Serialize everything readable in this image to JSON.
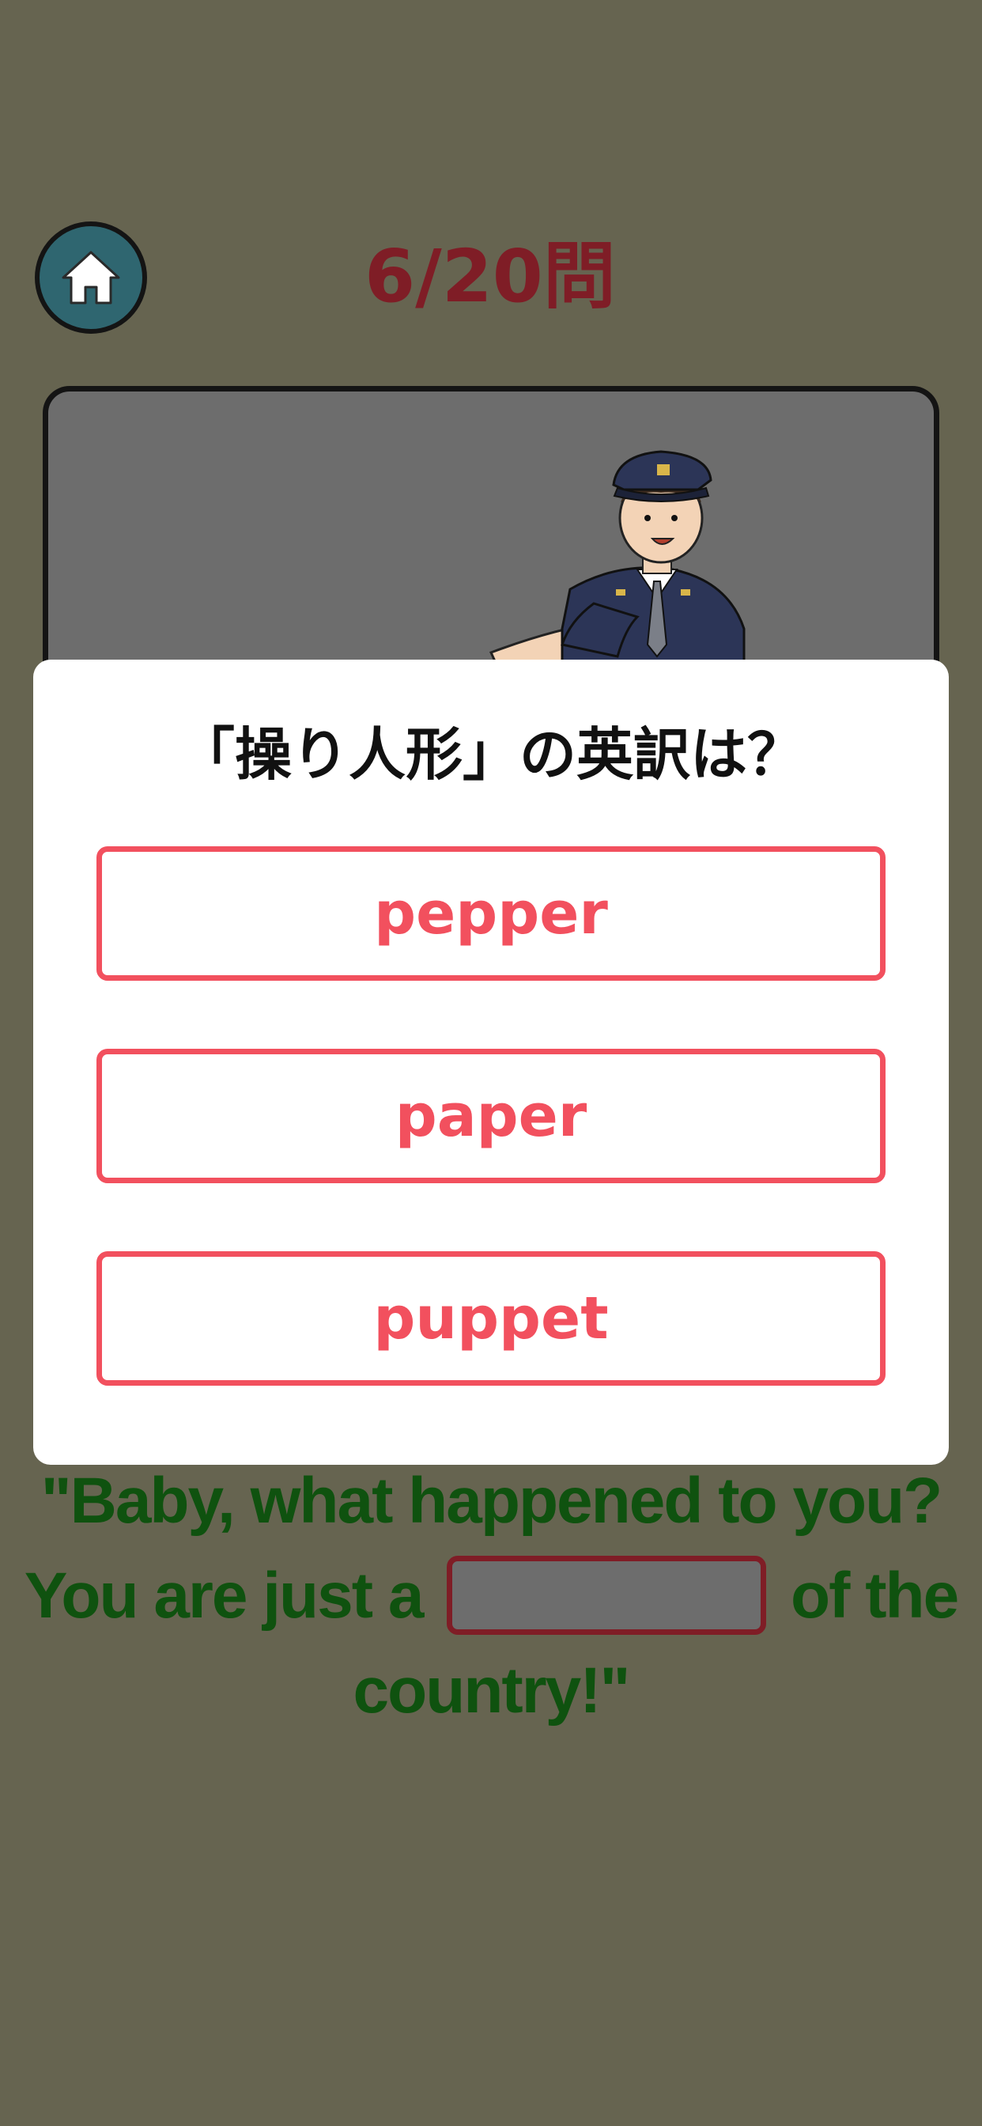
{
  "header": {
    "home_icon": "home-icon",
    "progress": "6/20問"
  },
  "scene": {
    "illustration": "police-officer"
  },
  "quiz": {
    "question": "「操り人形」の英訳は？",
    "choices": [
      "pepper",
      "paper",
      "puppet"
    ]
  },
  "sentence": {
    "line1": "\"Baby, what happened to you?",
    "line2_before": "You are just a",
    "line2_after": "of the",
    "line3": "country!\""
  },
  "colors": {
    "background": "#666450",
    "progress": "#7f1d26",
    "choice_accent": "#f2505e",
    "sentence_text": "#0f520f",
    "home_button": "#2f6670"
  }
}
